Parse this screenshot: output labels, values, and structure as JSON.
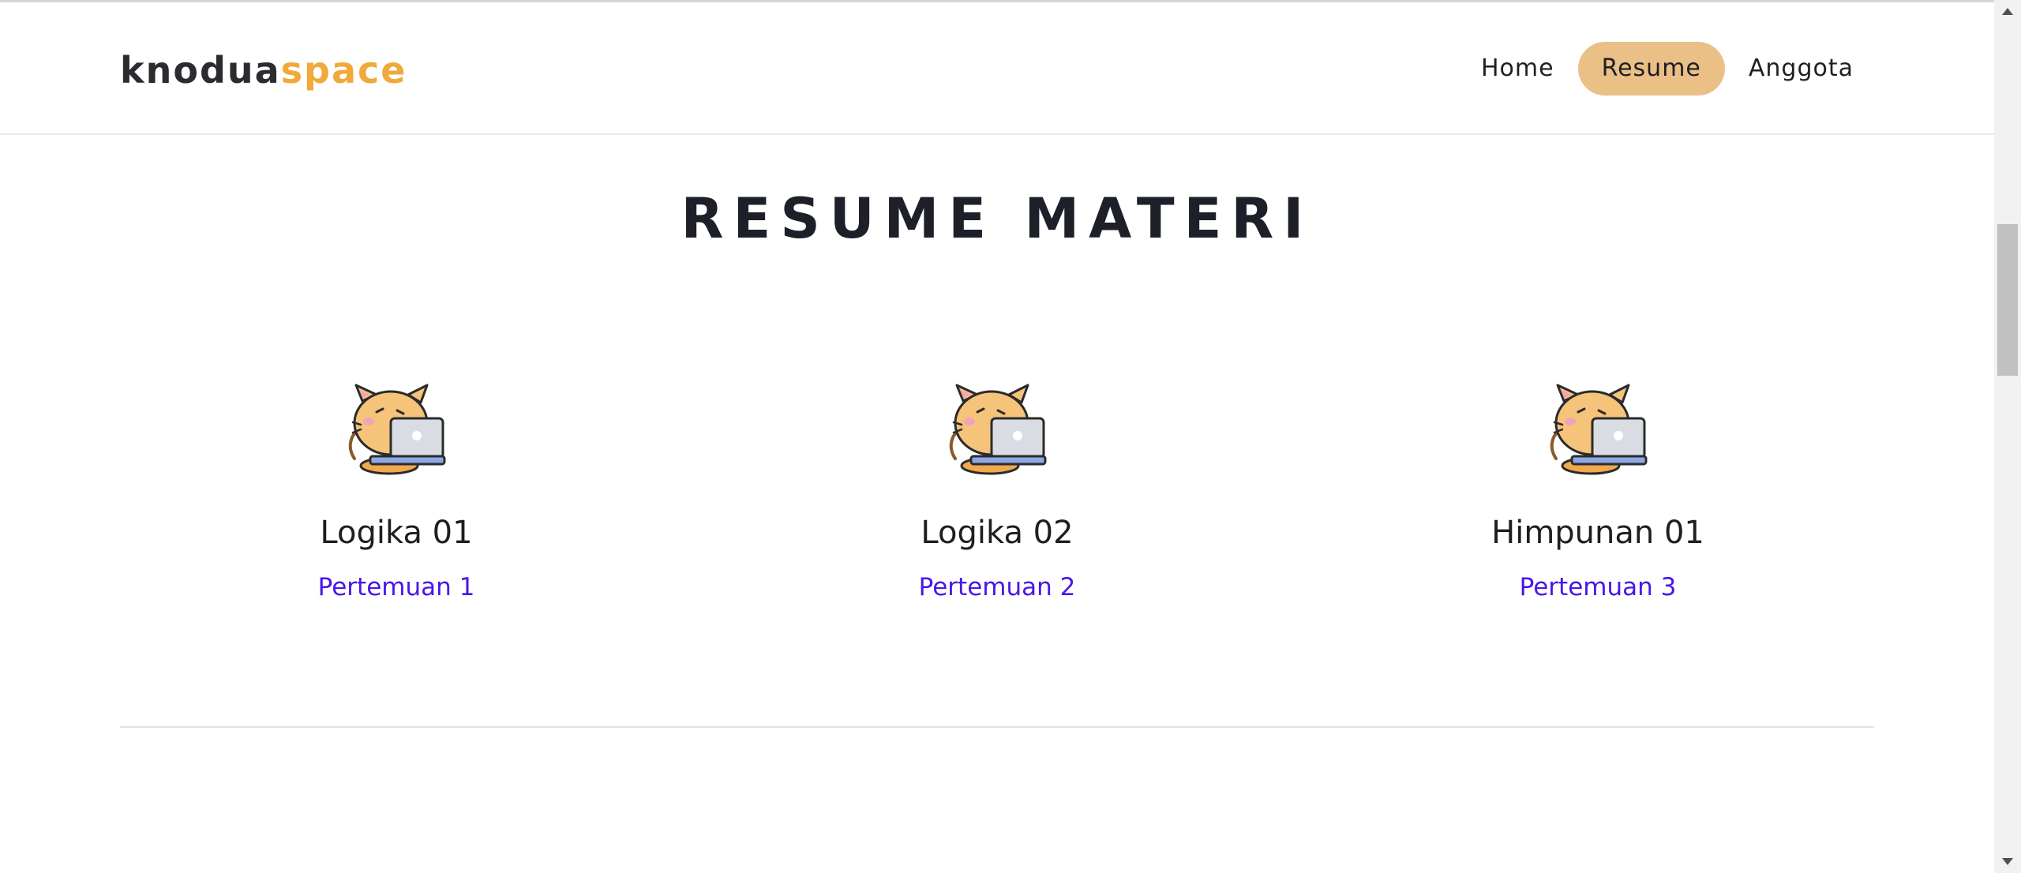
{
  "brand": {
    "part1": "knodua",
    "part2": "space"
  },
  "nav": {
    "items": [
      "Home",
      "Resume",
      "Anggota"
    ],
    "active": "Resume"
  },
  "section": {
    "title": "RESUME MATERI"
  },
  "cards": [
    {
      "title": "Logika 01",
      "link": "Pertemuan 1",
      "icon": "cat-laptop-icon"
    },
    {
      "title": "Logika 02",
      "link": "Pertemuan 2",
      "icon": "cat-laptop-icon"
    },
    {
      "title": "Himpunan 01",
      "link": "Pertemuan 3",
      "icon": "cat-laptop-icon"
    }
  ],
  "colors": {
    "accent": "#ebc086",
    "brand_accent": "#f0a93a",
    "link": "#4a16e8"
  }
}
